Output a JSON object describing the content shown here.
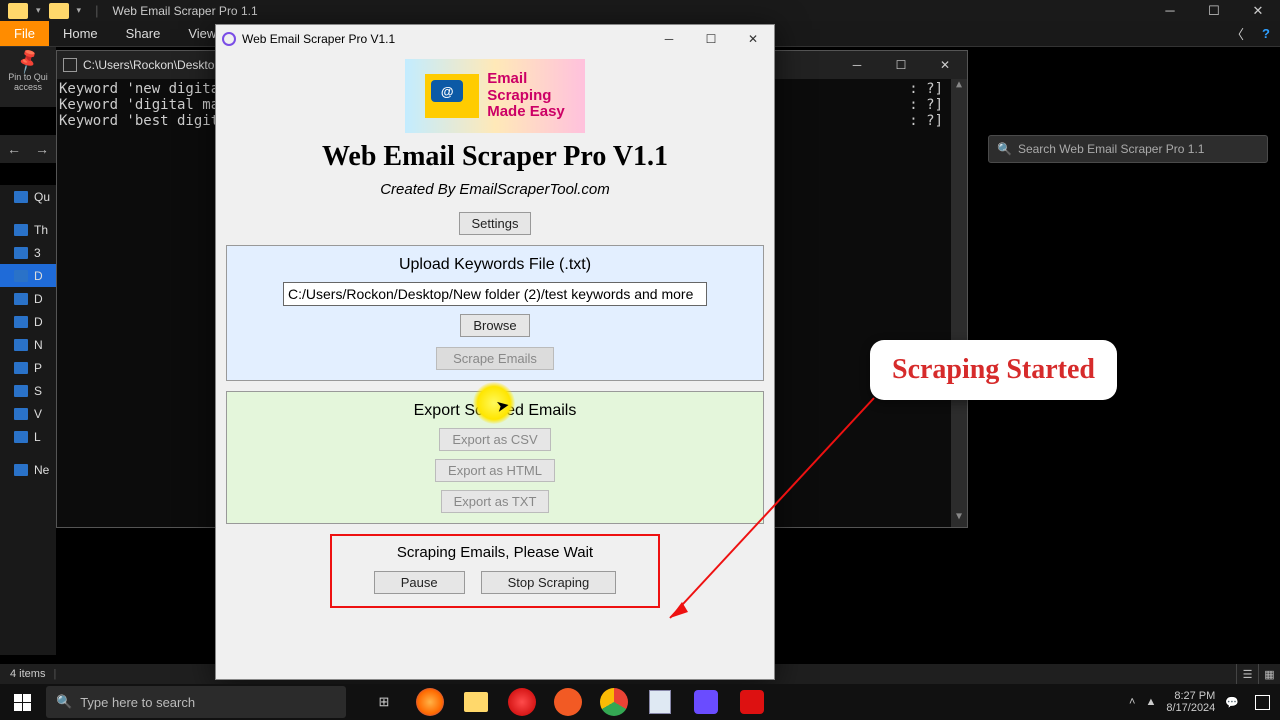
{
  "explorer": {
    "title": "Web Email Scraper Pro 1.1",
    "tabs": {
      "file": "File",
      "home": "Home",
      "share": "Share",
      "view": "View"
    },
    "pin_line1": "Pin to Qui",
    "pin_line2": "access",
    "breadcrumb": "C:\\Users\\Rockon\\Desktop",
    "search_placeholder": "Search Web Email Scraper Pro 1.1",
    "sidebar": [
      "Qu",
      "Th",
      "3",
      "D",
      "D",
      "D",
      "N",
      "P",
      "S",
      "V",
      "L",
      "Ne"
    ],
    "status": "4 items"
  },
  "console": {
    "title": "C:\\Users\\Rockon\\Desktop",
    "left_lines": [
      "Keyword 'new digital ",
      "Keyword 'digital mark",
      "Keyword 'best digital"
    ],
    "right_lines": [
      ": ?]",
      ": ?]",
      ": ?]"
    ]
  },
  "app": {
    "window_title": "Web Email Scraper Pro V1.1",
    "banner_lines": [
      "Email",
      "Scraping",
      "Made Easy"
    ],
    "heading": "Web Email Scraper Pro V1.1",
    "subtitle": "Created By EmailScraperTool.com",
    "settings_btn": "Settings",
    "upload": {
      "title": "Upload Keywords File (.txt)",
      "path": "C:/Users/Rockon/Desktop/New folder (2)/test keywords and more",
      "browse": "Browse",
      "scrape": "Scrape Emails"
    },
    "export": {
      "title": "Export Scraped Emails",
      "csv": "Export as CSV",
      "html": "Export as HTML",
      "txt": "Export as TXT"
    },
    "status": {
      "message": "Scraping Emails, Please Wait",
      "pause": "Pause",
      "stop": "Stop Scraping"
    }
  },
  "callout": "Scraping Started",
  "taskbar": {
    "search_placeholder": "Type here to search",
    "time": "8:27 PM",
    "date": "8/17/2024"
  }
}
